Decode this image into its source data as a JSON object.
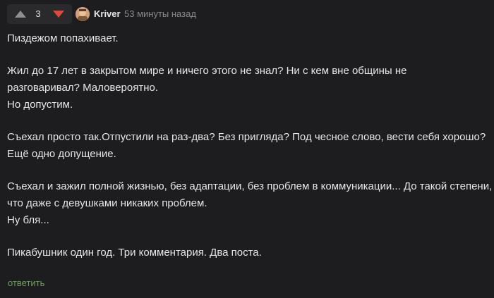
{
  "votes": {
    "count": "3"
  },
  "author": {
    "name": "Kriver",
    "time": "53 минуты назад"
  },
  "comment": {
    "paragraphs": [
      [
        "Пиздежом попахивает."
      ],
      [
        "Жил до 17 лет в закрытом мире и ничего этого не знал? Ни с кем вне общины не",
        "разговаривал? Маловероятно.",
        "Но допустим."
      ],
      [
        "Съехал просто так.Отпустили на раз-два? Без пригляда? Под чесное слово, вести себя хорошо?",
        "Ещё одно допущение."
      ],
      [
        "Съехал и зажил полной жизнью, без адаптации, без проблем в коммуникации... До такой степени,",
        "что даже с девушками никаких проблем.",
        "Ну бля..."
      ],
      [
        "Пикабушник один год. Три комментария. Два поста."
      ]
    ]
  },
  "actions": {
    "reply_label": "ответить"
  },
  "colors": {
    "background": "#1d1d1f",
    "upvote": "#8f8f8f",
    "downvote": "#e0483e",
    "reply": "#6e9f57"
  },
  "icons": {
    "upvote": "triangle-up-icon",
    "downvote": "triangle-down-icon"
  }
}
